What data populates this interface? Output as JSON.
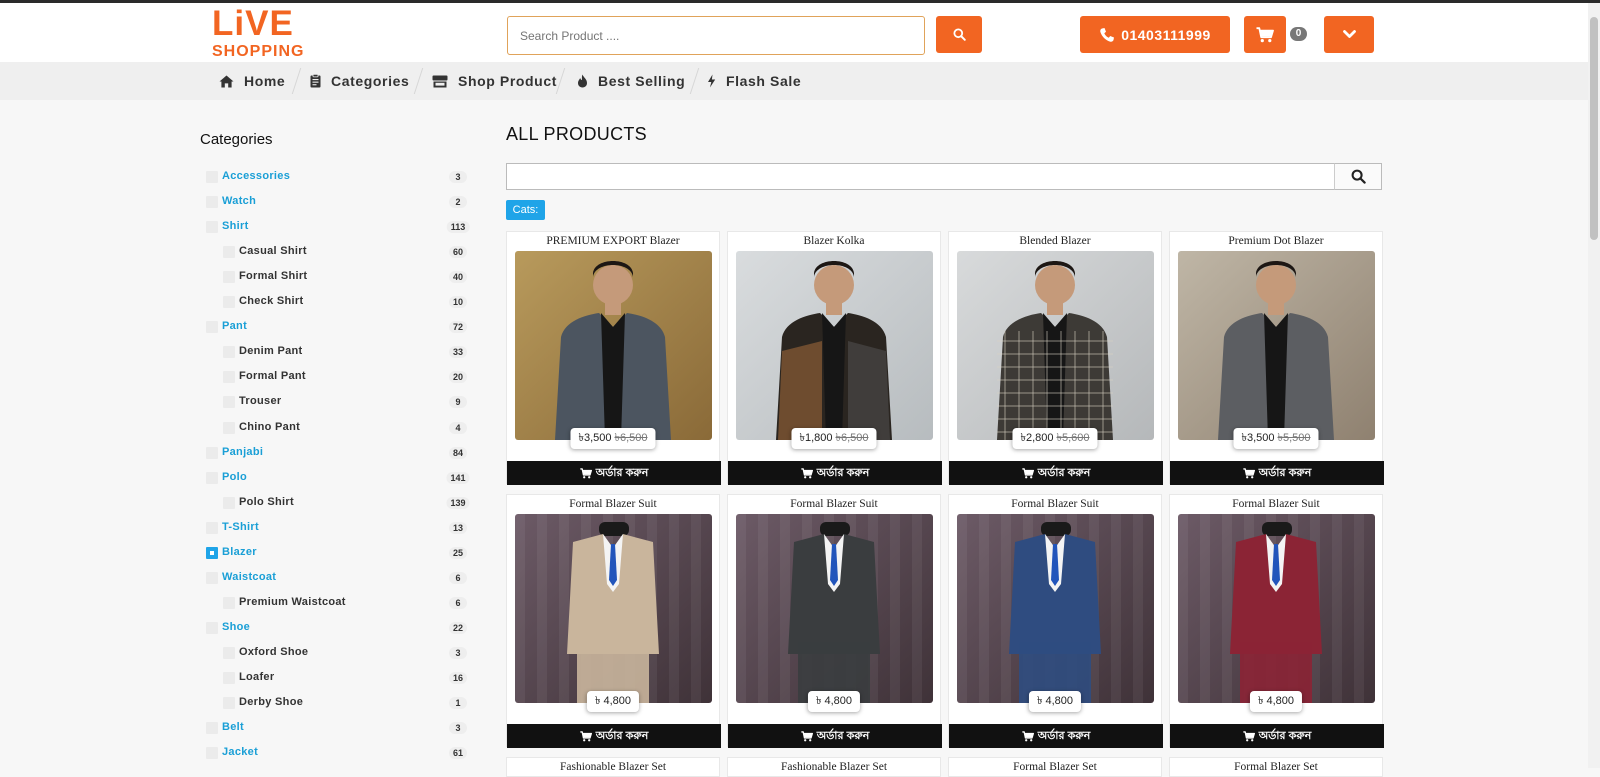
{
  "logo": {
    "line1": "LiVE",
    "line2": "SHOPPING"
  },
  "search": {
    "placeholder": "Search Product ...."
  },
  "header": {
    "phone": "01403111999",
    "cart_count": "0"
  },
  "nav": [
    "Home",
    "Categories",
    "Shop Product",
    "Best Selling",
    "Flash Sale"
  ],
  "sidebar": {
    "title": "Categories",
    "items": [
      {
        "label": "Accessories",
        "count": "3",
        "level": 0
      },
      {
        "label": "Watch",
        "count": "2",
        "level": 0
      },
      {
        "label": "Shirt",
        "count": "113",
        "level": 0
      },
      {
        "label": "Casual Shirt",
        "count": "60",
        "level": 1
      },
      {
        "label": "Formal Shirt",
        "count": "40",
        "level": 1
      },
      {
        "label": "Check Shirt",
        "count": "10",
        "level": 1
      },
      {
        "label": "Pant",
        "count": "72",
        "level": 0
      },
      {
        "label": "Denim Pant",
        "count": "33",
        "level": 1
      },
      {
        "label": "Formal Pant",
        "count": "20",
        "level": 1
      },
      {
        "label": "Trouser",
        "count": "9",
        "level": 1
      },
      {
        "label": "Chino Pant",
        "count": "4",
        "level": 1
      },
      {
        "label": "Panjabi",
        "count": "84",
        "level": 0
      },
      {
        "label": "Polo",
        "count": "141",
        "level": 0
      },
      {
        "label": "Polo Shirt",
        "count": "139",
        "level": 1
      },
      {
        "label": "T-Shirt",
        "count": "13",
        "level": 0
      },
      {
        "label": "Blazer",
        "count": "25",
        "level": 0,
        "checked": true
      },
      {
        "label": "Waistcoat",
        "count": "6",
        "level": 0
      },
      {
        "label": "Premium Waistcoat",
        "count": "6",
        "level": 1
      },
      {
        "label": "Shoe",
        "count": "22",
        "level": 0
      },
      {
        "label": "Oxford Shoe",
        "count": "3",
        "level": 1
      },
      {
        "label": "Loafer",
        "count": "16",
        "level": 1
      },
      {
        "label": "Derby Shoe",
        "count": "1",
        "level": 1
      },
      {
        "label": "Belt",
        "count": "3",
        "level": 0
      },
      {
        "label": "Jacket",
        "count": "61",
        "level": 0
      }
    ]
  },
  "main": {
    "title": "ALL PRODUCTS",
    "cats_label": "Cats:",
    "order_label": "অর্ডার করুন"
  },
  "products": [
    {
      "name": "PREMIUM EXPORT Blazer",
      "price": "৳3,500",
      "old_price": "৳6,500",
      "style": "grey"
    },
    {
      "name": "Blazer Kolka",
      "price": "৳1,800",
      "old_price": "৳6,500",
      "style": "kolka"
    },
    {
      "name": "Blended Blazer",
      "price": "৳2,800",
      "old_price": "৳5,600",
      "style": "check"
    },
    {
      "name": "Premium Dot Blazer",
      "price": "৳3,500",
      "old_price": "৳5,500",
      "style": "dot"
    },
    {
      "name": "Formal Blazer Suit",
      "price": "৳ 4,800",
      "old_price": "",
      "style": "beige"
    },
    {
      "name": "Formal Blazer Suit",
      "price": "৳ 4,800",
      "old_price": "",
      "style": "black"
    },
    {
      "name": "Formal Blazer Suit",
      "price": "৳ 4,800",
      "old_price": "",
      "style": "navy"
    },
    {
      "name": "Formal Blazer Suit",
      "price": "৳ 4,800",
      "old_price": "",
      "style": "maroon"
    },
    {
      "name": "Fashionable Blazer Set",
      "price": "",
      "old_price": "",
      "style": "none"
    },
    {
      "name": "Fashionable Blazer Set",
      "price": "",
      "old_price": "",
      "style": "none"
    },
    {
      "name": "Formal Blazer Set",
      "price": "",
      "old_price": "",
      "style": "none"
    },
    {
      "name": "Formal Blazer Set",
      "price": "",
      "old_price": "",
      "style": "none"
    }
  ],
  "colors": {
    "brand": "#f26522",
    "link": "#1a9fd6",
    "badge": "#1fa4e8"
  }
}
